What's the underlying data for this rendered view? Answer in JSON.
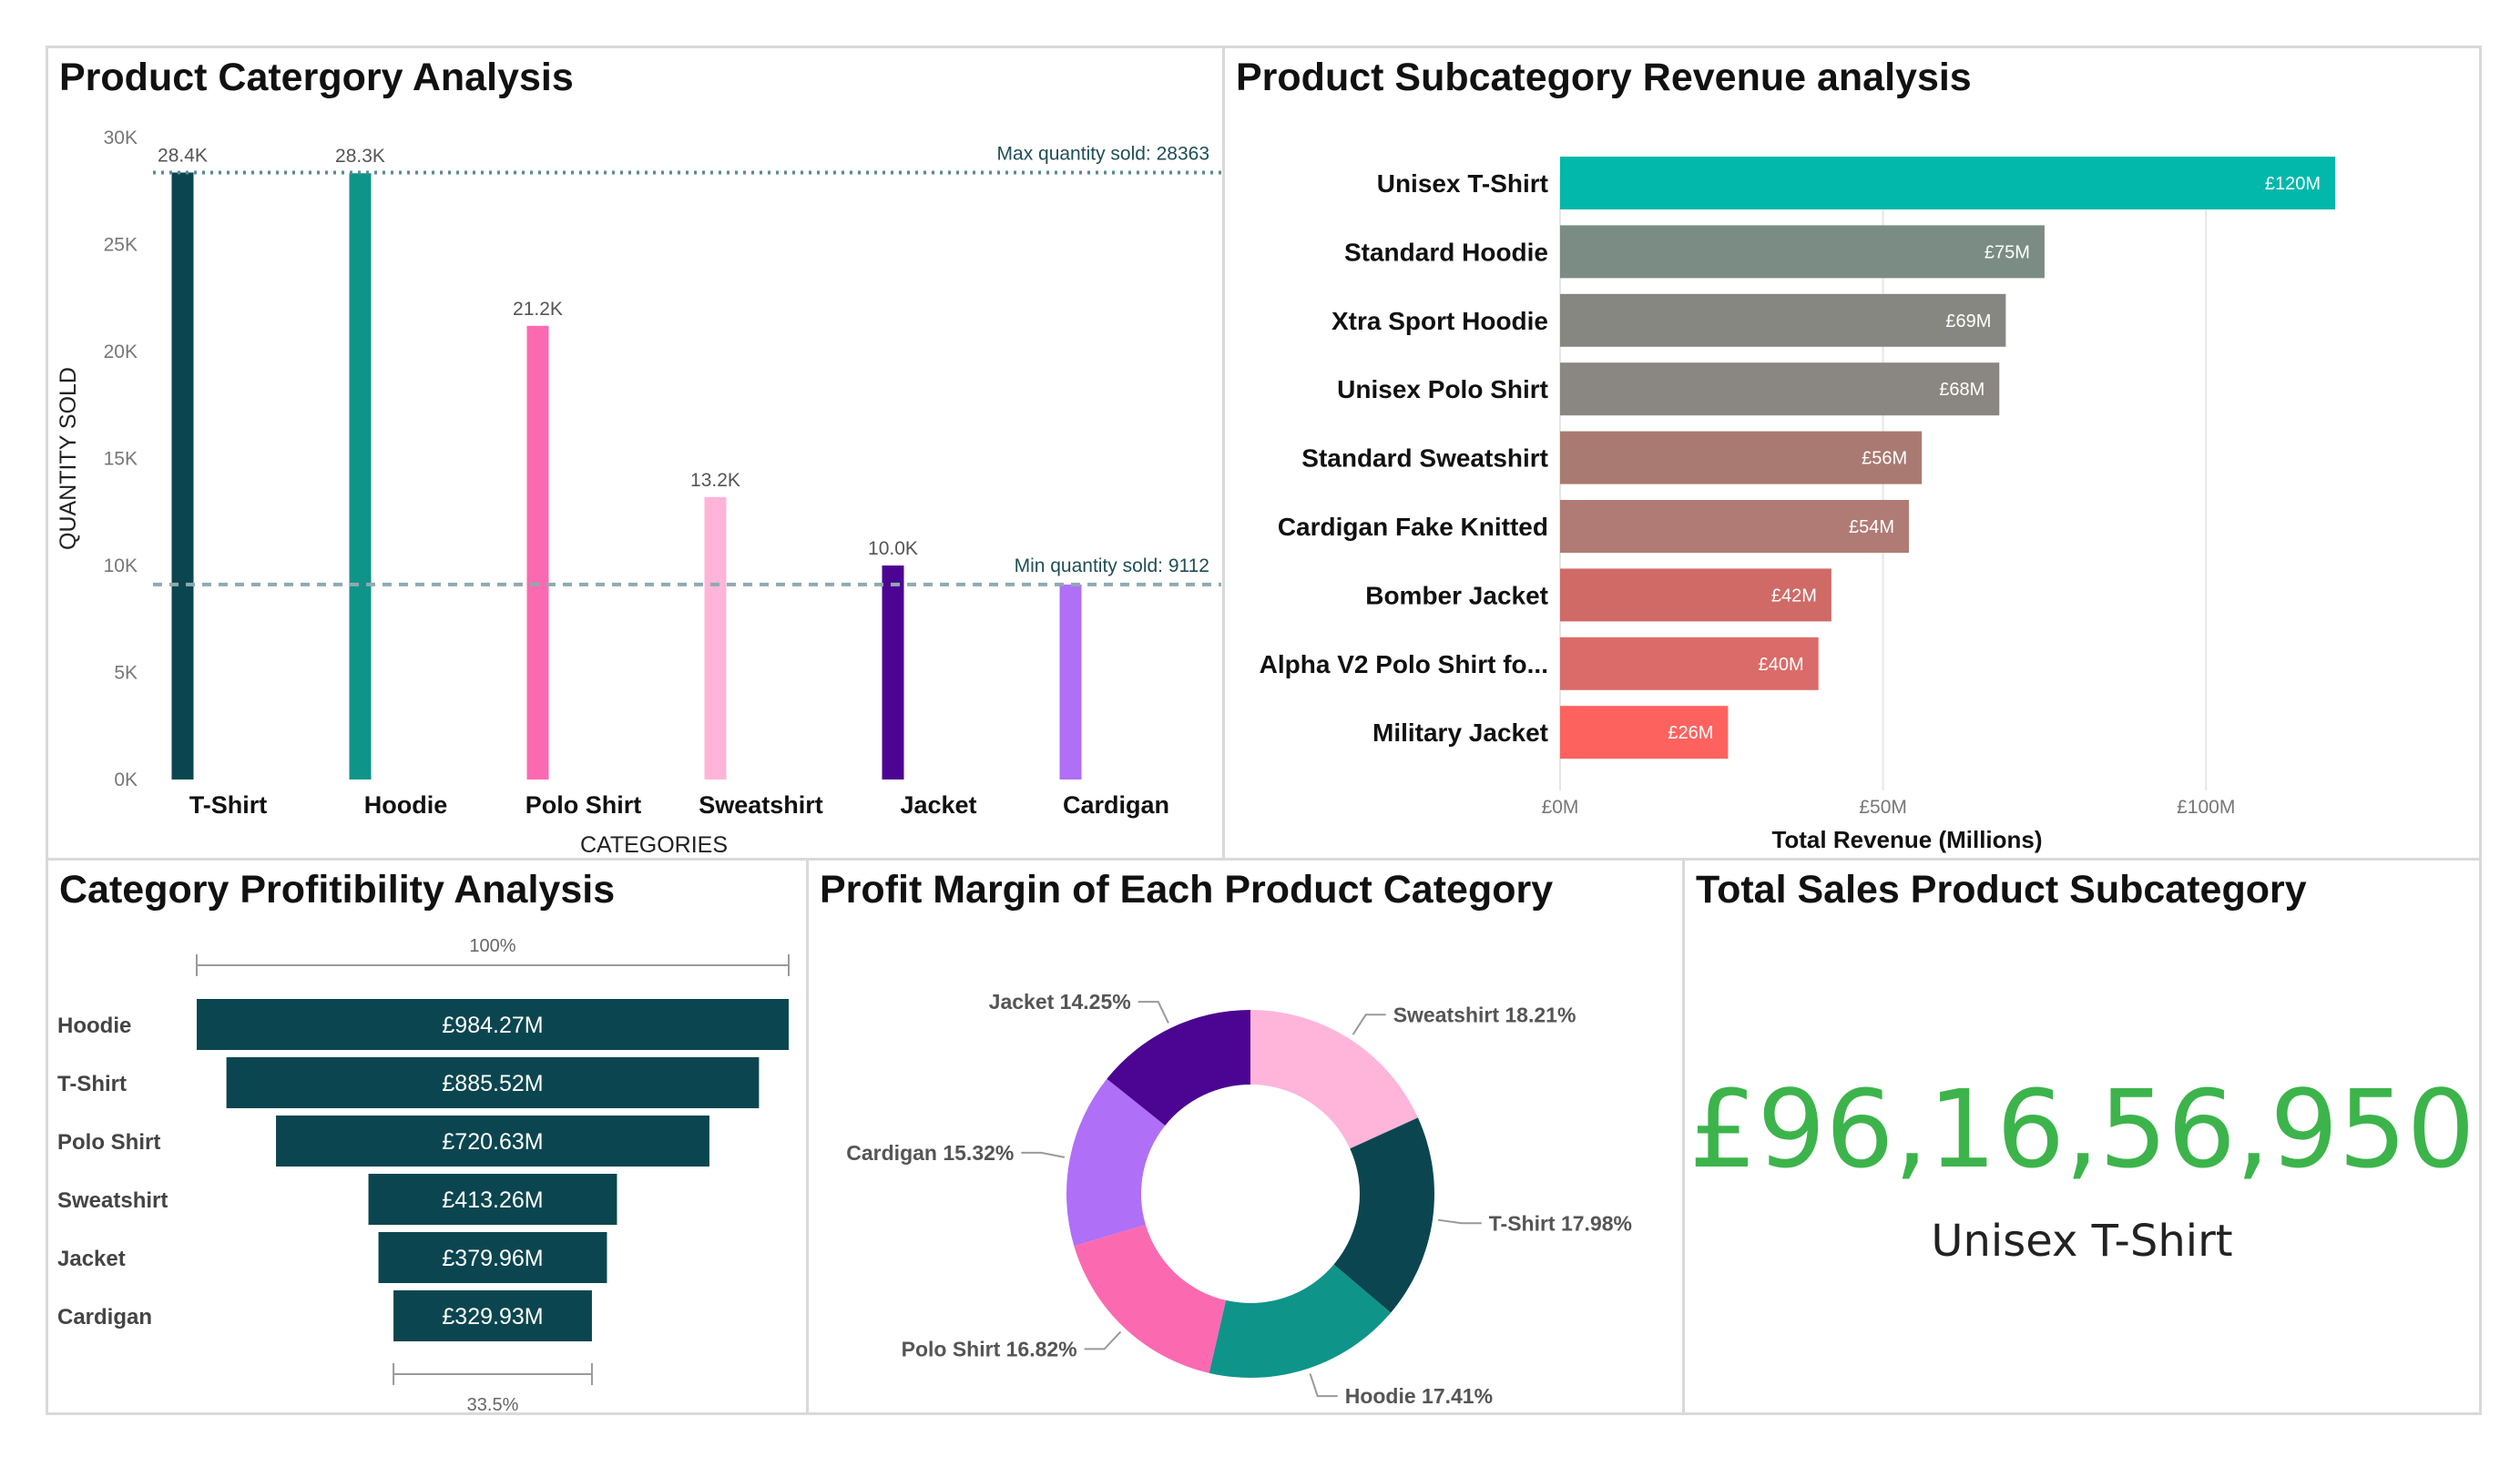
{
  "colors": {
    "category": {
      "T-Shirt": "#0b4650",
      "Hoodie": "#0f948a",
      "Polo Shirt": "#fb6ab1",
      "Sweatshirt": "#feb5d9",
      "Jacket": "#4c0592",
      "Cardigan": "#b06ff7"
    },
    "funnel_bar": "#0b4650",
    "kpi": "#3cb44b"
  },
  "panels": {
    "category_quantity": {
      "title": "Product Catergory Analysis"
    },
    "subcategory_revenue": {
      "title": "Product Subcategory Revenue analysis"
    },
    "profitability": {
      "title": "Category Profitibility Analysis"
    },
    "profit_margin": {
      "title": "Profit Margin of Each Product Category"
    },
    "total_sales": {
      "title": "Total Sales Product Subcategory",
      "value": "£96,16,56,950",
      "label": "Unisex T-Shirt"
    }
  },
  "chart_data": [
    {
      "type": "bar",
      "title": "Product Catergory Analysis",
      "xlabel": "CATEGORIES",
      "ylabel": "QUANTITY SOLD",
      "ylim": [
        0,
        30000
      ],
      "yticks": [
        0,
        5000,
        10000,
        15000,
        20000,
        25000,
        30000
      ],
      "ytick_labels": [
        "0K",
        "5K",
        "10K",
        "15K",
        "20K",
        "25K",
        "30K"
      ],
      "categories": [
        "T-Shirt",
        "Hoodie",
        "Polo Shirt",
        "Sweatshirt",
        "Jacket",
        "Cardigan"
      ],
      "values": [
        28363,
        28330,
        21200,
        13200,
        10000,
        9112
      ],
      "data_labels": [
        "28.4K",
        "28.3K",
        "21.2K",
        "13.2K",
        "10.0K",
        ""
      ],
      "reference_lines": [
        {
          "label": "Max quantity sold: 28363",
          "value": 28363,
          "style": "dotted",
          "color": "#5b8a94"
        },
        {
          "label": "Min quantity sold: 9112",
          "value": 9112,
          "style": "dashed",
          "color": "#8faab0"
        }
      ]
    },
    {
      "type": "bar",
      "orientation": "horizontal",
      "title": "Product Subcategory Revenue analysis",
      "xlabel": "Total Revenue (Millions)",
      "xlim": [
        0,
        130
      ],
      "xticks": [
        0,
        50,
        100
      ],
      "xtick_labels": [
        "£0M",
        "£50M",
        "£100M"
      ],
      "grid": true,
      "categories": [
        "Unisex T-Shirt",
        "Standard Hoodie",
        "Xtra Sport Hoodie",
        "Unisex Polo Shirt",
        "Standard Sweatshirt",
        "Cardigan Fake Knitted",
        "Bomber Jacket",
        "Alpha V2 Polo Shirt fo...",
        "Military Jacket"
      ],
      "values": [
        120,
        75,
        69,
        68,
        56,
        54,
        42,
        40,
        26
      ],
      "data_labels": [
        "£120M",
        "£75M",
        "£69M",
        "£68M",
        "£56M",
        "£54M",
        "£42M",
        "£40M",
        "£26M"
      ],
      "bar_colors": [
        "#01b8aa",
        "#7a8c84",
        "#878781",
        "#8a8682",
        "#a97a72",
        "#b07b74",
        "#d06a66",
        "#da6b69",
        "#fd625e"
      ]
    },
    {
      "type": "funnel",
      "title": "Category Profitibility Analysis",
      "categories": [
        "Hoodie",
        "T-Shirt",
        "Polo Shirt",
        "Sweatshirt",
        "Jacket",
        "Cardigan"
      ],
      "values": [
        984.27,
        885.52,
        720.63,
        413.26,
        379.96,
        329.93
      ],
      "data_labels": [
        "£984.27M",
        "£885.52M",
        "£720.63M",
        "£413.26M",
        "£379.96M",
        "£329.93M"
      ],
      "top_label": "100%",
      "bottom_label": "33.5%"
    },
    {
      "type": "pie",
      "donut": true,
      "title": "Profit Margin of Each Product Category",
      "categories": [
        "Sweatshirt",
        "T-Shirt",
        "Hoodie",
        "Polo Shirt",
        "Cardigan",
        "Jacket"
      ],
      "values": [
        18.21,
        17.98,
        17.41,
        16.82,
        15.32,
        14.25
      ],
      "labels": [
        "Sweatshirt 18.21%",
        "T-Shirt 17.98%",
        "Hoodie 17.41%",
        "Polo Shirt 16.82%",
        "Cardigan 15.32%",
        "Jacket 14.25%"
      ]
    }
  ]
}
